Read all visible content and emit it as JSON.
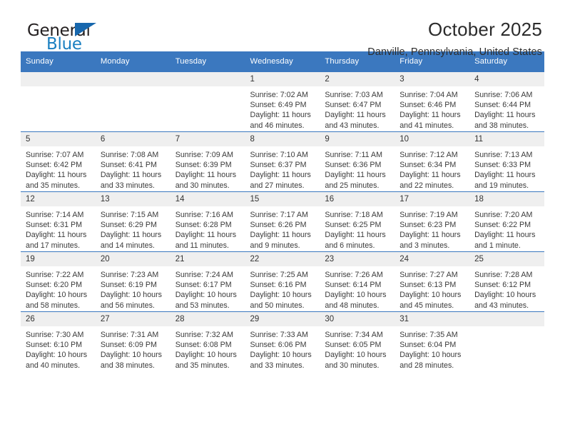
{
  "logo": {
    "word_one": "General",
    "word_two": "Blue",
    "triangle_color": "#1767ad"
  },
  "header": {
    "title": "October 2025",
    "location": "Danville, Pennsylvania, United States",
    "accent_color": "#3b78bf",
    "daynum_band_color": "#efefef"
  },
  "weekday_headers": [
    "Sunday",
    "Monday",
    "Tuesday",
    "Wednesday",
    "Thursday",
    "Friday",
    "Saturday"
  ],
  "weeks": [
    [
      {
        "day": "",
        "empty": true,
        "sunrise": "",
        "sunset": "",
        "daylight": ""
      },
      {
        "day": "",
        "empty": true,
        "sunrise": "",
        "sunset": "",
        "daylight": ""
      },
      {
        "day": "",
        "empty": true,
        "sunrise": "",
        "sunset": "",
        "daylight": ""
      },
      {
        "day": "1",
        "empty": false,
        "sunrise": "Sunrise: 7:02 AM",
        "sunset": "Sunset: 6:49 PM",
        "daylight": "Daylight: 11 hours and 46 minutes."
      },
      {
        "day": "2",
        "empty": false,
        "sunrise": "Sunrise: 7:03 AM",
        "sunset": "Sunset: 6:47 PM",
        "daylight": "Daylight: 11 hours and 43 minutes."
      },
      {
        "day": "3",
        "empty": false,
        "sunrise": "Sunrise: 7:04 AM",
        "sunset": "Sunset: 6:46 PM",
        "daylight": "Daylight: 11 hours and 41 minutes."
      },
      {
        "day": "4",
        "empty": false,
        "sunrise": "Sunrise: 7:06 AM",
        "sunset": "Sunset: 6:44 PM",
        "daylight": "Daylight: 11 hours and 38 minutes."
      }
    ],
    [
      {
        "day": "5",
        "empty": false,
        "sunrise": "Sunrise: 7:07 AM",
        "sunset": "Sunset: 6:42 PM",
        "daylight": "Daylight: 11 hours and 35 minutes."
      },
      {
        "day": "6",
        "empty": false,
        "sunrise": "Sunrise: 7:08 AM",
        "sunset": "Sunset: 6:41 PM",
        "daylight": "Daylight: 11 hours and 33 minutes."
      },
      {
        "day": "7",
        "empty": false,
        "sunrise": "Sunrise: 7:09 AM",
        "sunset": "Sunset: 6:39 PM",
        "daylight": "Daylight: 11 hours and 30 minutes."
      },
      {
        "day": "8",
        "empty": false,
        "sunrise": "Sunrise: 7:10 AM",
        "sunset": "Sunset: 6:37 PM",
        "daylight": "Daylight: 11 hours and 27 minutes."
      },
      {
        "day": "9",
        "empty": false,
        "sunrise": "Sunrise: 7:11 AM",
        "sunset": "Sunset: 6:36 PM",
        "daylight": "Daylight: 11 hours and 25 minutes."
      },
      {
        "day": "10",
        "empty": false,
        "sunrise": "Sunrise: 7:12 AM",
        "sunset": "Sunset: 6:34 PM",
        "daylight": "Daylight: 11 hours and 22 minutes."
      },
      {
        "day": "11",
        "empty": false,
        "sunrise": "Sunrise: 7:13 AM",
        "sunset": "Sunset: 6:33 PM",
        "daylight": "Daylight: 11 hours and 19 minutes."
      }
    ],
    [
      {
        "day": "12",
        "empty": false,
        "sunrise": "Sunrise: 7:14 AM",
        "sunset": "Sunset: 6:31 PM",
        "daylight": "Daylight: 11 hours and 17 minutes."
      },
      {
        "day": "13",
        "empty": false,
        "sunrise": "Sunrise: 7:15 AM",
        "sunset": "Sunset: 6:29 PM",
        "daylight": "Daylight: 11 hours and 14 minutes."
      },
      {
        "day": "14",
        "empty": false,
        "sunrise": "Sunrise: 7:16 AM",
        "sunset": "Sunset: 6:28 PM",
        "daylight": "Daylight: 11 hours and 11 minutes."
      },
      {
        "day": "15",
        "empty": false,
        "sunrise": "Sunrise: 7:17 AM",
        "sunset": "Sunset: 6:26 PM",
        "daylight": "Daylight: 11 hours and 9 minutes."
      },
      {
        "day": "16",
        "empty": false,
        "sunrise": "Sunrise: 7:18 AM",
        "sunset": "Sunset: 6:25 PM",
        "daylight": "Daylight: 11 hours and 6 minutes."
      },
      {
        "day": "17",
        "empty": false,
        "sunrise": "Sunrise: 7:19 AM",
        "sunset": "Sunset: 6:23 PM",
        "daylight": "Daylight: 11 hours and 3 minutes."
      },
      {
        "day": "18",
        "empty": false,
        "sunrise": "Sunrise: 7:20 AM",
        "sunset": "Sunset: 6:22 PM",
        "daylight": "Daylight: 11 hours and 1 minute."
      }
    ],
    [
      {
        "day": "19",
        "empty": false,
        "sunrise": "Sunrise: 7:22 AM",
        "sunset": "Sunset: 6:20 PM",
        "daylight": "Daylight: 10 hours and 58 minutes."
      },
      {
        "day": "20",
        "empty": false,
        "sunrise": "Sunrise: 7:23 AM",
        "sunset": "Sunset: 6:19 PM",
        "daylight": "Daylight: 10 hours and 56 minutes."
      },
      {
        "day": "21",
        "empty": false,
        "sunrise": "Sunrise: 7:24 AM",
        "sunset": "Sunset: 6:17 PM",
        "daylight": "Daylight: 10 hours and 53 minutes."
      },
      {
        "day": "22",
        "empty": false,
        "sunrise": "Sunrise: 7:25 AM",
        "sunset": "Sunset: 6:16 PM",
        "daylight": "Daylight: 10 hours and 50 minutes."
      },
      {
        "day": "23",
        "empty": false,
        "sunrise": "Sunrise: 7:26 AM",
        "sunset": "Sunset: 6:14 PM",
        "daylight": "Daylight: 10 hours and 48 minutes."
      },
      {
        "day": "24",
        "empty": false,
        "sunrise": "Sunrise: 7:27 AM",
        "sunset": "Sunset: 6:13 PM",
        "daylight": "Daylight: 10 hours and 45 minutes."
      },
      {
        "day": "25",
        "empty": false,
        "sunrise": "Sunrise: 7:28 AM",
        "sunset": "Sunset: 6:12 PM",
        "daylight": "Daylight: 10 hours and 43 minutes."
      }
    ],
    [
      {
        "day": "26",
        "empty": false,
        "sunrise": "Sunrise: 7:30 AM",
        "sunset": "Sunset: 6:10 PM",
        "daylight": "Daylight: 10 hours and 40 minutes."
      },
      {
        "day": "27",
        "empty": false,
        "sunrise": "Sunrise: 7:31 AM",
        "sunset": "Sunset: 6:09 PM",
        "daylight": "Daylight: 10 hours and 38 minutes."
      },
      {
        "day": "28",
        "empty": false,
        "sunrise": "Sunrise: 7:32 AM",
        "sunset": "Sunset: 6:08 PM",
        "daylight": "Daylight: 10 hours and 35 minutes."
      },
      {
        "day": "29",
        "empty": false,
        "sunrise": "Sunrise: 7:33 AM",
        "sunset": "Sunset: 6:06 PM",
        "daylight": "Daylight: 10 hours and 33 minutes."
      },
      {
        "day": "30",
        "empty": false,
        "sunrise": "Sunrise: 7:34 AM",
        "sunset": "Sunset: 6:05 PM",
        "daylight": "Daylight: 10 hours and 30 minutes."
      },
      {
        "day": "31",
        "empty": false,
        "sunrise": "Sunrise: 7:35 AM",
        "sunset": "Sunset: 6:04 PM",
        "daylight": "Daylight: 10 hours and 28 minutes."
      },
      {
        "day": "",
        "empty": true,
        "sunrise": "",
        "sunset": "",
        "daylight": ""
      }
    ]
  ]
}
